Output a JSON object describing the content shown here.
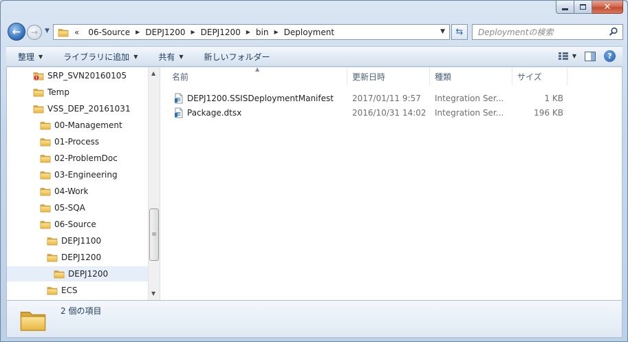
{
  "address": {
    "overflow": "«",
    "crumbs": [
      "06-Source",
      "DEPJ1200",
      "DEPJ1200",
      "bin",
      "Deployment"
    ]
  },
  "search": {
    "placeholder": "Deploymentの検索"
  },
  "toolbar": {
    "organize": "整理",
    "add_to_library": "ライブラリに追加",
    "share": "共有",
    "new_folder": "新しいフォルダー"
  },
  "nav": {
    "items": [
      {
        "label": "SRP_SVN20160105",
        "icon": "folder-warning-icon"
      },
      {
        "label": "Temp",
        "icon": "folder-icon"
      },
      {
        "label": "VSS_DEP_20161031",
        "icon": "folder-icon"
      },
      {
        "label": "00-Management",
        "icon": "folder-icon"
      },
      {
        "label": "01-Process",
        "icon": "folder-icon"
      },
      {
        "label": "02-ProblemDoc",
        "icon": "folder-icon"
      },
      {
        "label": "03-Engineering",
        "icon": "folder-icon"
      },
      {
        "label": "04-Work",
        "icon": "folder-icon"
      },
      {
        "label": "05-SQA",
        "icon": "folder-icon"
      },
      {
        "label": "06-Source",
        "icon": "folder-icon"
      },
      {
        "label": "DEPJ1100",
        "icon": "folder-icon"
      },
      {
        "label": "DEPJ1200",
        "icon": "folder-icon"
      },
      {
        "label": "DEPJ1200",
        "icon": "folder-icon"
      },
      {
        "label": "ECS",
        "icon": "folder-icon"
      }
    ]
  },
  "columns": {
    "name": "名前",
    "date": "更新日時",
    "type": "種類",
    "size": "サイズ"
  },
  "files": [
    {
      "name": "DEPJ1200.SSISDeploymentManifest",
      "date": "2017/01/11 9:57",
      "type": "Integration Ser...",
      "size": "1 KB",
      "icon": "ssis-file-icon"
    },
    {
      "name": "Package.dtsx",
      "date": "2016/10/31 14:02",
      "type": "Integration Ser...",
      "size": "196 KB",
      "icon": "ssis-file-icon"
    }
  ],
  "status": {
    "item_count": "2 個の項目"
  },
  "colors": {
    "selection": "#e5eef9",
    "folder": "#f2c95c",
    "accent": "#1f5aa8"
  }
}
